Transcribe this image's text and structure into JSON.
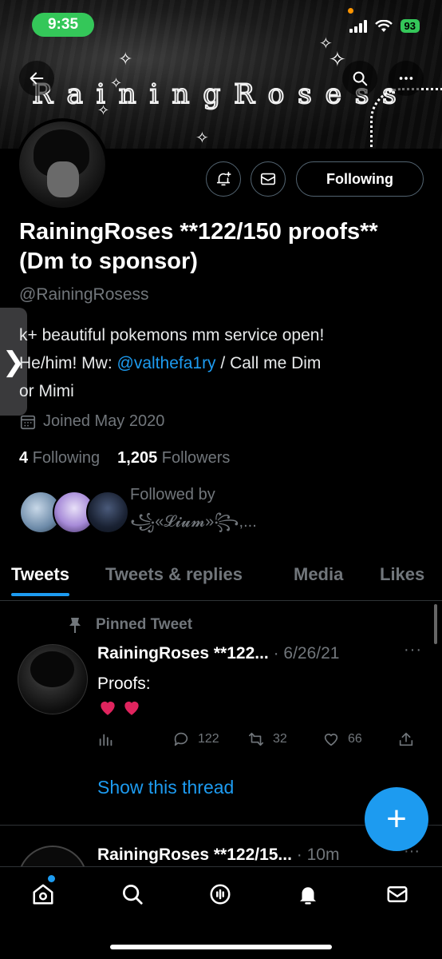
{
  "status_bar": {
    "time": "9:35",
    "battery": "93"
  },
  "banner": {
    "title": "RainingRosess"
  },
  "profile": {
    "display_name": "RainingRoses **122/150 proofs** (Dm to sponsor)",
    "handle": "@RainingRosess",
    "bio_line1": "k+ beautiful pokemons mm service open!",
    "bio_line2_prefix": "He/him! Mw: ",
    "bio_mention": "@valthefa1ry",
    "bio_line2_suffix": " / Call me Dim",
    "bio_line3": "or Mimi",
    "joined": "Joined May 2020",
    "following_count": "4",
    "following_label": "Following",
    "followers_count": "1,205",
    "followers_label": "Followers",
    "followed_by_label": "Followed by",
    "followed_by_names": "꧁«𝓛𝓲𝓾𝓶»꧂,..."
  },
  "buttons": {
    "following": "Following"
  },
  "side_tab": {
    "glyph": "❯"
  },
  "tabs": [
    {
      "label": "Tweets"
    },
    {
      "label": "Tweets & replies"
    },
    {
      "label": "Media"
    },
    {
      "label": "Likes"
    }
  ],
  "pinned_tweet": {
    "pinned_label": "Pinned Tweet",
    "author": "RainingRoses **122...",
    "date": " · 6/26/21",
    "more": "···",
    "text": "Proofs:",
    "replies": "122",
    "retweets": "32",
    "likes": "66",
    "show_thread": "Show this thread"
  },
  "next_tweet": {
    "author": "RainingRoses **122/15...",
    "date": " · 10m",
    "more": "···"
  },
  "fab": {
    "label": "+"
  },
  "colors": {
    "accent": "#1d9bf0",
    "status_green": "#34c759",
    "heart": "#e0245e"
  }
}
